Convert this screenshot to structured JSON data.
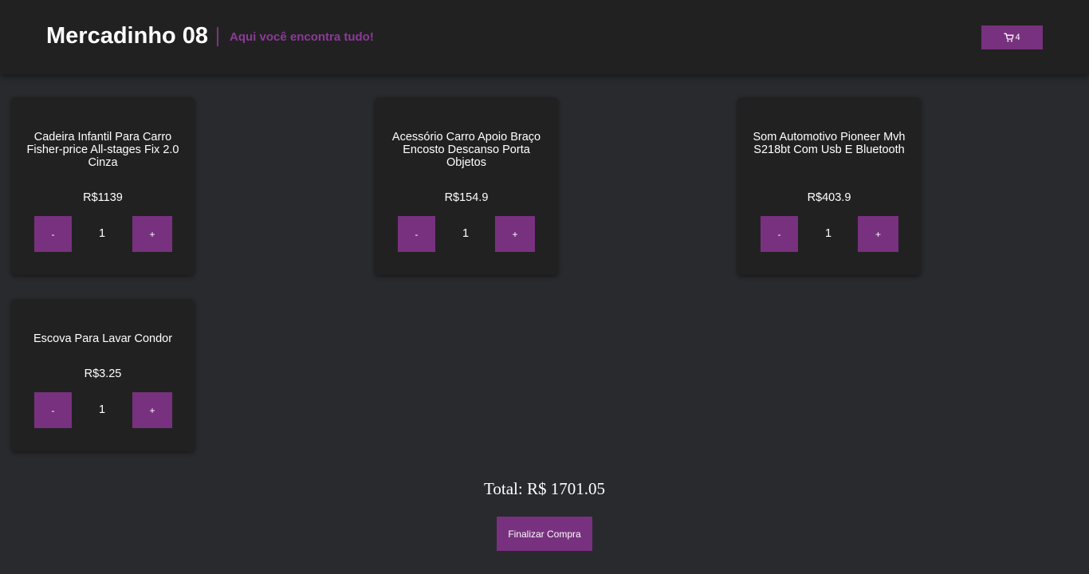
{
  "header": {
    "brand": "Mercadinho 08",
    "tagline": "Aqui você encontra tudo!",
    "cart_count": "4",
    "cart_icon": "cart-icon"
  },
  "products": [
    {
      "title": "Cadeira Infantil Para Carro Fisher-price All-stages Fix 2.0 Cinza",
      "price": "R$1139",
      "quantity": "1",
      "minus": "-",
      "plus": "+"
    },
    {
      "title": "Acessório Carro Apoio Braço Encosto Descanso Porta Objetos",
      "price": "R$154.9",
      "quantity": "1",
      "minus": "-",
      "plus": "+"
    },
    {
      "title": "Som Automotivo Pioneer Mvh S218bt Com Usb E Bluetooth",
      "price": "R$403.9",
      "quantity": "1",
      "minus": "-",
      "plus": "+"
    },
    {
      "title": "Escova Para Lavar Condor",
      "price": "R$3.25",
      "quantity": "1",
      "minus": "-",
      "plus": "+"
    }
  ],
  "summary": {
    "total": "Total: R$ 1701.05",
    "checkout_label": "Finalizar Compra"
  },
  "colors": {
    "background": "#282a2e",
    "panel": "#222122",
    "accent": "#78317f",
    "tagline": "#8b3a98"
  }
}
